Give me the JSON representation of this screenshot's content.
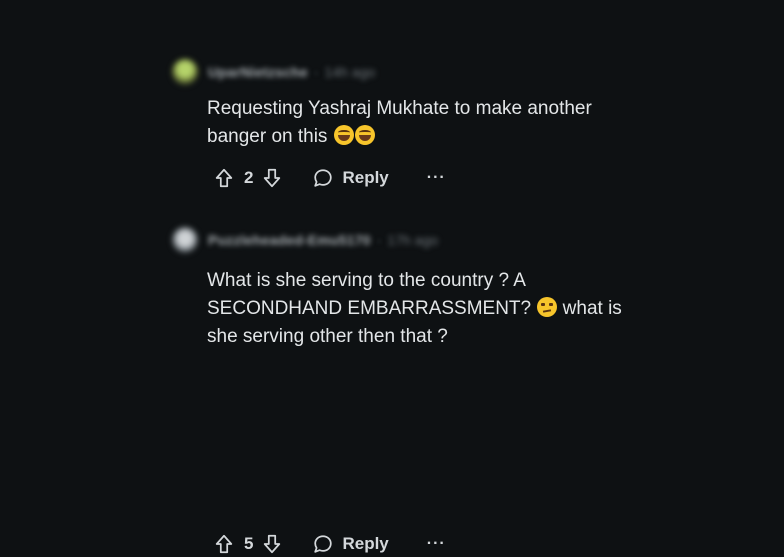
{
  "comments": [
    {
      "username": "UparNietzsche",
      "separator": "·",
      "time": "14h ago",
      "avatar_icon": "avatar-icon",
      "text": "Requesting Yashraj Mukhate to make another banger on this",
      "emojis": [
        "rolling-on-floor-laughing-emoji",
        "rolling-on-floor-laughing-emoji"
      ],
      "votes": "2",
      "reply_label": "Reply",
      "more_label": "···"
    },
    {
      "username": "Puzzleheaded-Emu5170",
      "separator": "·",
      "time": "17h ago",
      "avatar_icon": "avatar-icon",
      "text_before_emoji": "What is she serving to the country ? A SECONDHAND EMBARRASSMENT?",
      "emoji": "unamused-face-emoji",
      "text_after_emoji": "what is she serving other then that ?",
      "votes": "5",
      "reply_label": "Reply",
      "more_label": "···"
    }
  ],
  "colors": {
    "background": "#0e1113",
    "text": "#e3e6e8",
    "muted": "#6c7378"
  },
  "icons": [
    "upvote-icon",
    "downvote-icon",
    "reply-bubble-icon",
    "more-options-icon"
  ]
}
